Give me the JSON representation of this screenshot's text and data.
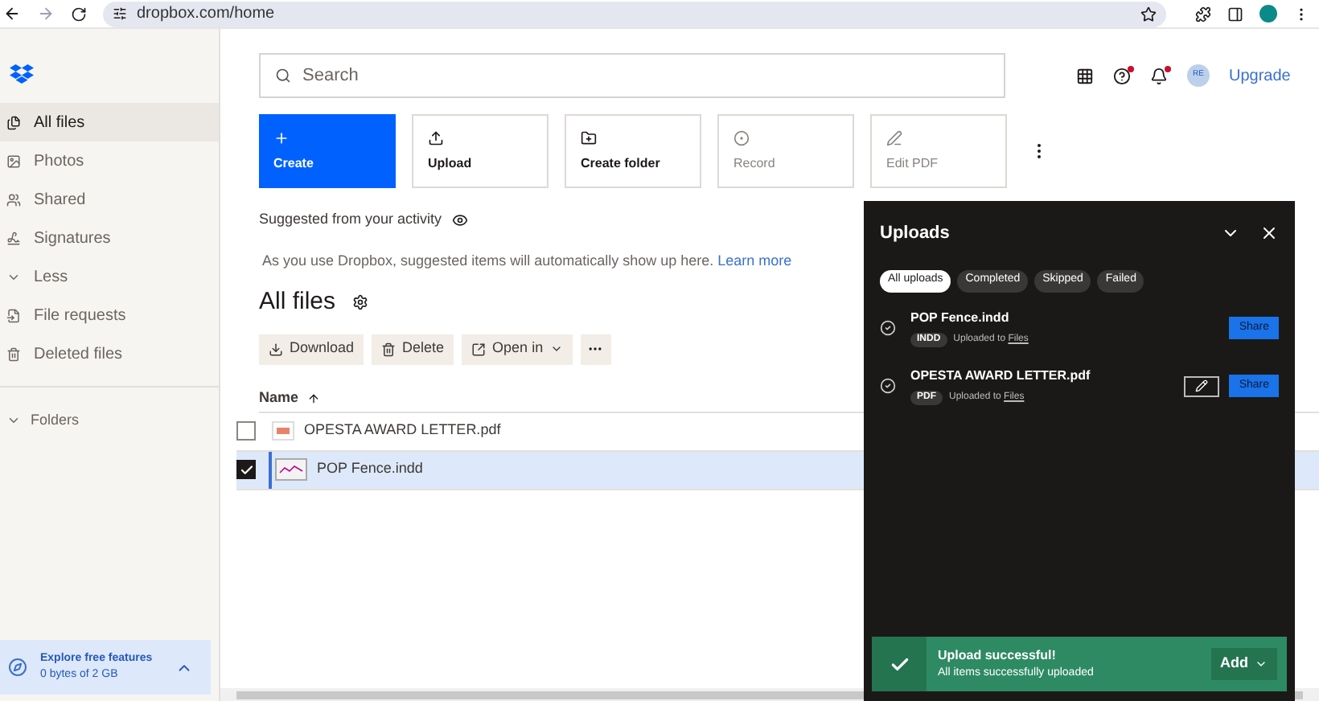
{
  "browser": {
    "url": "dropbox.com/home"
  },
  "sidebar": {
    "items": [
      {
        "label": "All files",
        "selected": true
      },
      {
        "label": "Photos",
        "selected": false
      },
      {
        "label": "Shared",
        "selected": false
      },
      {
        "label": "Signatures",
        "selected": false
      },
      {
        "label": "Less",
        "selected": false
      },
      {
        "label": "File requests",
        "selected": false
      },
      {
        "label": "Deleted files",
        "selected": false
      }
    ],
    "folders": "Folders",
    "promo": {
      "title": "Explore free features",
      "subtitle": "0 bytes of 2 GB"
    }
  },
  "header": {
    "search_placeholder": "Search",
    "avatar": "RE",
    "upgrade": "Upgrade"
  },
  "actions": [
    {
      "label": "Create",
      "kind": "primary"
    },
    {
      "label": "Upload",
      "kind": "default"
    },
    {
      "label": "Create folder",
      "kind": "default"
    },
    {
      "label": "Record",
      "kind": "disabled"
    },
    {
      "label": "Edit PDF",
      "kind": "disabled"
    }
  ],
  "suggested": {
    "title": "Suggested from your activity",
    "info": "As you use Dropbox, suggested items will automatically show up here.",
    "link": "Learn more"
  },
  "files": {
    "title": "All files",
    "toolbar": [
      {
        "label": "Download"
      },
      {
        "label": "Delete"
      },
      {
        "label": "Open in",
        "kind": "menu"
      }
    ],
    "column": "Name",
    "rows": [
      {
        "name": "OPESTA AWARD LETTER.pdf",
        "kind": "pdf",
        "checked": false,
        "selected": false
      },
      {
        "name": "POP Fence.indd",
        "kind": "indd",
        "checked": true,
        "selected": true
      }
    ]
  },
  "uploads": {
    "title": "Uploads",
    "filters": [
      {
        "label": "All uploads",
        "selected": true
      },
      {
        "label": "Completed",
        "selected": false
      },
      {
        "label": "Skipped",
        "selected": false
      },
      {
        "label": "Failed",
        "selected": false
      }
    ],
    "items": [
      {
        "name": "POP Fence.indd",
        "type": "INDD",
        "destination_prefix": "Uploaded to",
        "destination": "Files",
        "editable": false,
        "action": "Share"
      },
      {
        "name": "OPESTA AWARD LETTER.pdf",
        "type": "PDF",
        "destination_prefix": "Uploaded to",
        "destination": "Files",
        "editable": true,
        "action": "Share"
      }
    ],
    "toast": {
      "title": "Upload successful!",
      "message": "All items successfully uploaded",
      "button": "Add"
    }
  }
}
